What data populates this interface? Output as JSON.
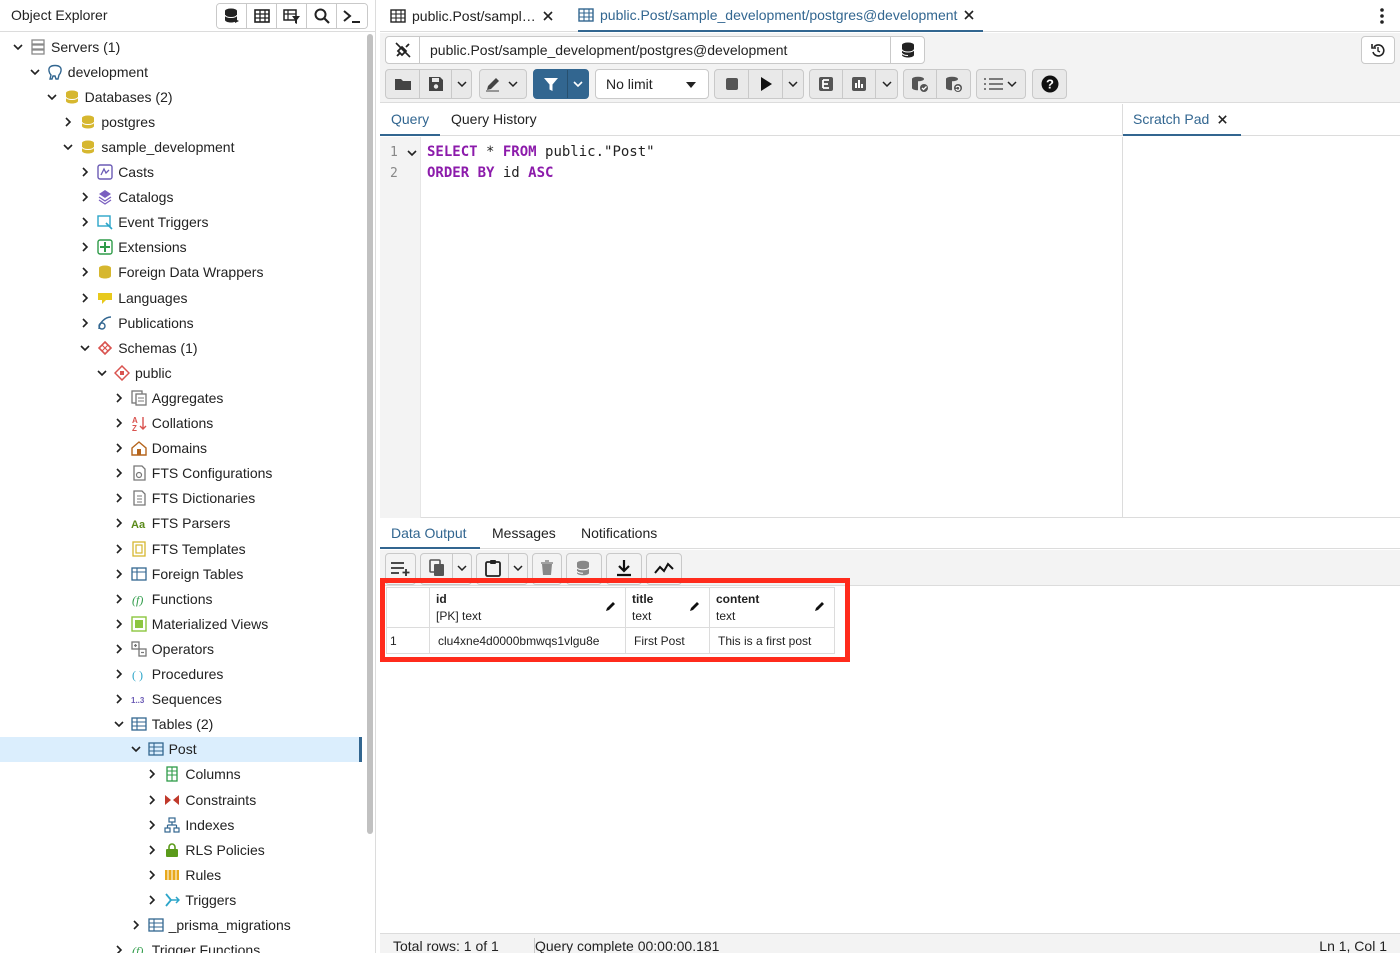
{
  "object_explorer": {
    "title": "Object Explorer",
    "tools": [
      "database-icon",
      "table-icon",
      "query-tool-icon",
      "search-icon",
      "terminal-icon"
    ]
  },
  "tree": [
    {
      "label": "Servers (1)",
      "level": 0,
      "expanded": true,
      "icon": "servers-icon",
      "color": "#8a8a8a"
    },
    {
      "label": "development",
      "level": 1,
      "expanded": true,
      "icon": "postgres-elephant-icon",
      "color": "#326690"
    },
    {
      "label": "Databases (2)",
      "level": 2,
      "expanded": true,
      "icon": "databases-icon",
      "color": "#d6b72f"
    },
    {
      "label": "postgres",
      "level": 3,
      "expanded": false,
      "icon": "database-icon",
      "color": "#d6b72f"
    },
    {
      "label": "sample_development",
      "level": 3,
      "expanded": true,
      "icon": "database-icon",
      "color": "#d6b72f"
    },
    {
      "label": "Casts",
      "level": 4,
      "expanded": false,
      "icon": "casts-icon",
      "color": "#6b5bb5"
    },
    {
      "label": "Catalogs",
      "level": 4,
      "expanded": false,
      "icon": "catalogs-icon",
      "color": "#7a5fc0"
    },
    {
      "label": "Event Triggers",
      "level": 4,
      "expanded": false,
      "icon": "event-triggers-icon",
      "color": "#2ca5c9"
    },
    {
      "label": "Extensions",
      "level": 4,
      "expanded": false,
      "icon": "extensions-icon",
      "color": "#2e9b48"
    },
    {
      "label": "Foreign Data Wrappers",
      "level": 4,
      "expanded": false,
      "icon": "fdw-icon",
      "color": "#d6b72f"
    },
    {
      "label": "Languages",
      "level": 4,
      "expanded": false,
      "icon": "languages-icon",
      "color": "#e8c91c"
    },
    {
      "label": "Publications",
      "level": 4,
      "expanded": false,
      "icon": "publications-icon",
      "color": "#326690"
    },
    {
      "label": "Schemas (1)",
      "level": 4,
      "expanded": true,
      "icon": "schemas-icon",
      "color": "#d9534f"
    },
    {
      "label": "public",
      "level": 5,
      "expanded": true,
      "icon": "schema-icon",
      "color": "#d9534f"
    },
    {
      "label": "Aggregates",
      "level": 6,
      "expanded": false,
      "icon": "aggregates-icon",
      "color": "#777777"
    },
    {
      "label": "Collations",
      "level": 6,
      "expanded": false,
      "icon": "collations-icon",
      "color": "#d9534f"
    },
    {
      "label": "Domains",
      "level": 6,
      "expanded": false,
      "icon": "domains-icon",
      "color": "#b5651d"
    },
    {
      "label": "FTS Configurations",
      "level": 6,
      "expanded": false,
      "icon": "fts-configurations-icon",
      "color": "#777777"
    },
    {
      "label": "FTS Dictionaries",
      "level": 6,
      "expanded": false,
      "icon": "fts-dictionaries-icon",
      "color": "#777777"
    },
    {
      "label": "FTS Parsers",
      "level": 6,
      "expanded": false,
      "icon": "fts-parsers-icon",
      "color": "#5a8a1a"
    },
    {
      "label": "FTS Templates",
      "level": 6,
      "expanded": false,
      "icon": "fts-templates-icon",
      "color": "#d6b72f"
    },
    {
      "label": "Foreign Tables",
      "level": 6,
      "expanded": false,
      "icon": "foreign-tables-icon",
      "color": "#326690"
    },
    {
      "label": "Functions",
      "level": 6,
      "expanded": false,
      "icon": "functions-icon",
      "color": "#2e9b48"
    },
    {
      "label": "Materialized Views",
      "level": 6,
      "expanded": false,
      "icon": "materialized-views-icon",
      "color": "#8cc63f"
    },
    {
      "label": "Operators",
      "level": 6,
      "expanded": false,
      "icon": "operators-icon",
      "color": "#777777"
    },
    {
      "label": "Procedures",
      "level": 6,
      "expanded": false,
      "icon": "procedures-icon",
      "color": "#2ca5c9"
    },
    {
      "label": "Sequences",
      "level": 6,
      "expanded": false,
      "icon": "sequences-icon",
      "color": "#6b5bb5"
    },
    {
      "label": "Tables (2)",
      "level": 6,
      "expanded": true,
      "icon": "tables-icon",
      "color": "#326690"
    },
    {
      "label": "Post",
      "level": 7,
      "expanded": true,
      "icon": "table-icon",
      "color": "#326690",
      "selected": true
    },
    {
      "label": "Columns",
      "level": 8,
      "expanded": false,
      "icon": "columns-icon",
      "color": "#2e9b48"
    },
    {
      "label": "Constraints",
      "level": 8,
      "expanded": false,
      "icon": "constraints-icon",
      "color": "#c0392b"
    },
    {
      "label": "Indexes",
      "level": 8,
      "expanded": false,
      "icon": "indexes-icon",
      "color": "#326690"
    },
    {
      "label": "RLS Policies",
      "level": 8,
      "expanded": false,
      "icon": "rls-policies-icon",
      "color": "#5a9a1a"
    },
    {
      "label": "Rules",
      "level": 8,
      "expanded": false,
      "icon": "rules-icon",
      "color": "#e8a91c"
    },
    {
      "label": "Triggers",
      "level": 8,
      "expanded": false,
      "icon": "triggers-icon",
      "color": "#2ca5c9"
    },
    {
      "label": "_prisma_migrations",
      "level": 7,
      "expanded": false,
      "icon": "table-icon",
      "color": "#326690"
    },
    {
      "label": "Trigger Functions",
      "level": 6,
      "expanded": false,
      "icon": "trigger-functions-icon",
      "color": "#2e9b48"
    }
  ],
  "tabs": [
    {
      "label": "public.Post/sampl…",
      "active": false
    },
    {
      "label": "public.Post/sample_development/postgres@development",
      "active": true
    }
  ],
  "connection": {
    "label": "public.Post/sample_development/postgres@development"
  },
  "toolbar": {
    "limit": "No limit"
  },
  "editor": {
    "tabs": {
      "query": "Query",
      "history": "Query History"
    },
    "scratch_pad": "Scratch Pad",
    "lines": [
      {
        "num": "1",
        "tokens": [
          {
            "t": "SELECT",
            "kw": true
          },
          {
            "t": " * ",
            "kw": false
          },
          {
            "t": "FROM",
            "kw": true
          },
          {
            "t": " public.\"Post\"",
            "kw": false
          }
        ]
      },
      {
        "num": "2",
        "tokens": [
          {
            "t": "ORDER BY",
            "kw": true
          },
          {
            "t": " id ",
            "kw": false
          },
          {
            "t": "ASC",
            "kw": true
          }
        ]
      }
    ]
  },
  "output": {
    "tabs": {
      "data": "Data Output",
      "messages": "Messages",
      "notifications": "Notifications"
    },
    "columns": [
      {
        "name": "id",
        "type": "[PK] text"
      },
      {
        "name": "title",
        "type": "text"
      },
      {
        "name": "content",
        "type": "text"
      }
    ],
    "rows": [
      {
        "rownum": "1",
        "cells": [
          "clu4xne4d0000bmwqs1vlgu8e",
          "First Post",
          "This is a first post"
        ]
      }
    ],
    "highlight_color": "#ff2b1c"
  },
  "status": {
    "rows": "Total rows: 1 of 1",
    "query": "Query complete 00:00:00.181",
    "position": "Ln 1, Col 1"
  },
  "colors": {
    "accent": "#326690",
    "selection": "#dbeefd"
  }
}
